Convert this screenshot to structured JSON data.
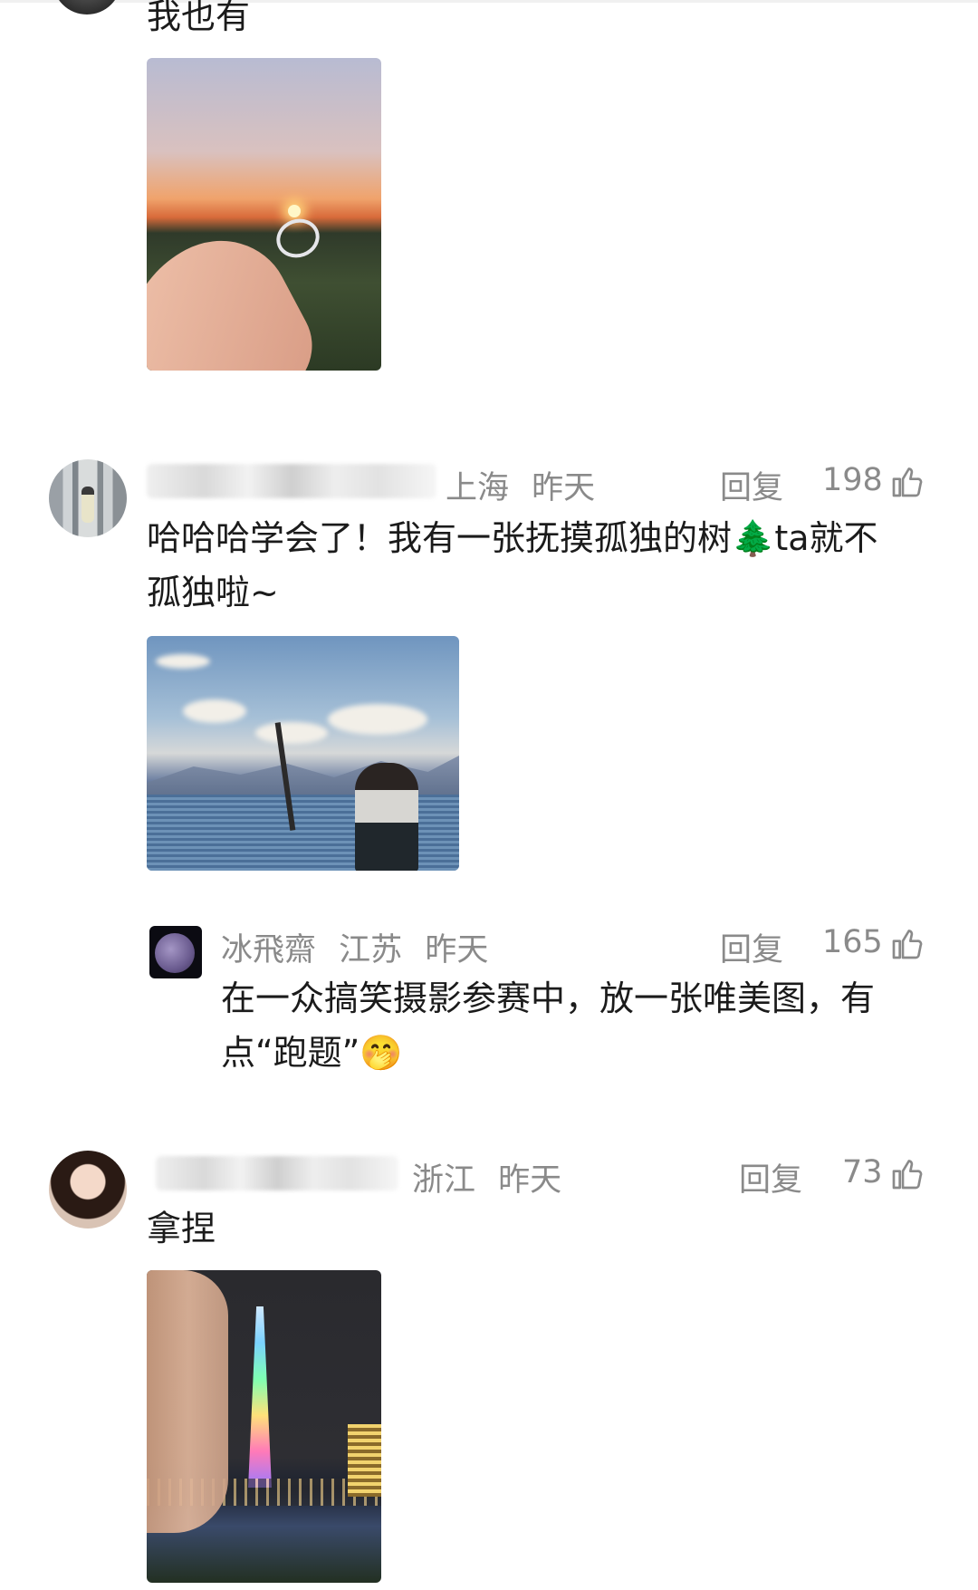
{
  "comments": [
    {
      "text": "我也有"
    },
    {
      "location": "上海",
      "time": "昨天",
      "reply_label": "回复",
      "likes": "198",
      "text_line1": "哈哈哈学会了！我有一张抚摸孤独的树🌲ta就不",
      "text_line2": "孤独啦~",
      "replies": [
        {
          "username": "冰飛齋",
          "location": "江苏",
          "time": "昨天",
          "reply_label": "回复",
          "likes": "165",
          "text_line1": "在一众搞笑摄影参赛中，放一张唯美图，有",
          "text_line2": "点“跑题”🤭"
        }
      ]
    },
    {
      "location": "浙江",
      "time": "昨天",
      "reply_label": "回复",
      "likes": "73",
      "text": "拿捏"
    }
  ],
  "icons": {
    "like": "thumbs-up-icon"
  },
  "colors": {
    "meta": "#8a8a8a",
    "text": "#1b1b1b"
  }
}
